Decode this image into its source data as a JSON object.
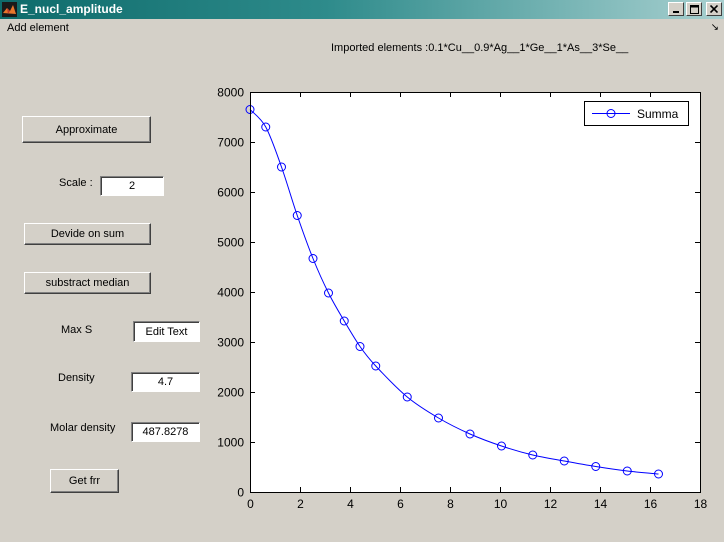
{
  "window": {
    "title": "E_nucl_amplitude"
  },
  "menu": {
    "add_element": "Add element",
    "arrow": "↘"
  },
  "imported_elements": "Imported elements :0.1*Cu__0.9*Ag__1*Ge__1*As__3*Se__",
  "controls": {
    "approximate": "Approximate",
    "scale_label": "Scale :",
    "scale_value": "2",
    "devide_on_sum": "Devide on sum",
    "substract_median": "substract median",
    "max_s_label": "Max S",
    "max_s_value": "Edit Text",
    "density_label": "Density",
    "density_value": "4.7",
    "molar_density_label": "Molar density",
    "molar_density_value": "487.8278",
    "get_frr": "Get frr"
  },
  "chart_data": {
    "type": "line",
    "xlim": [
      0,
      18
    ],
    "ylim": [
      0,
      8000
    ],
    "x_ticks": [
      0,
      2,
      4,
      6,
      8,
      10,
      12,
      14,
      16,
      18
    ],
    "y_ticks": [
      0,
      1000,
      2000,
      3000,
      4000,
      5000,
      6000,
      7000,
      8000
    ],
    "grid": false,
    "legend_position": "top-right",
    "series": [
      {
        "name": "Summa",
        "color": "#0000ff",
        "marker": "circle",
        "x": [
          0,
          0.63,
          1.26,
          1.89,
          2.52,
          3.14,
          3.77,
          4.4,
          5.03,
          6.29,
          7.54,
          8.8,
          10.06,
          11.31,
          12.57,
          13.83,
          15.09,
          16.34
        ],
        "y": [
          7650,
          7300,
          6500,
          5530,
          4670,
          3980,
          3420,
          2910,
          2520,
          1900,
          1480,
          1160,
          920,
          740,
          620,
          510,
          420,
          360
        ]
      }
    ]
  }
}
